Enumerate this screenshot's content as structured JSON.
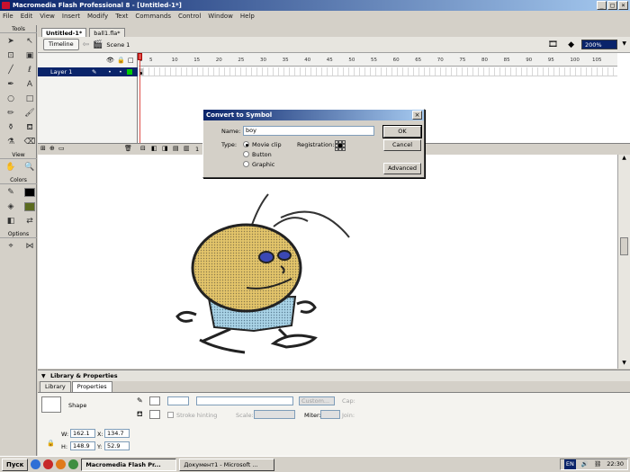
{
  "window": {
    "title": "Macromedia Flash Professional 8 - [Untitled-1*]",
    "controls": [
      "_",
      "□",
      "×"
    ]
  },
  "menu": [
    "File",
    "Edit",
    "View",
    "Insert",
    "Modify",
    "Text",
    "Commands",
    "Control",
    "Window",
    "Help"
  ],
  "tools": {
    "header": "Tools",
    "view_label": "View",
    "colors_label": "Colors",
    "options_label": "Options",
    "stroke_color": "#000000",
    "fill_color": "#5c6b1f"
  },
  "documents": {
    "tabs": [
      "Untitled-1*",
      "ball1.fla*"
    ]
  },
  "timeline": {
    "button": "Timeline",
    "scene": "Scene 1",
    "zoom": "200%",
    "layer_name": "Layer 1",
    "ruler_ticks": [
      "1",
      "5",
      "10",
      "15",
      "20",
      "25",
      "30",
      "35",
      "40",
      "45",
      "50",
      "55",
      "60",
      "65",
      "70",
      "75",
      "80",
      "85",
      "90",
      "95",
      "100",
      "105"
    ],
    "current_frame": "1"
  },
  "dialog": {
    "title": "Convert to Symbol",
    "name_label": "Name:",
    "name_value": "boy",
    "type_label": "Type:",
    "options": [
      "Movie clip",
      "Button",
      "Graphic"
    ],
    "selected_option": "Movie clip",
    "registration_label": "Registration:",
    "ok": "OK",
    "cancel": "Cancel",
    "advanced": "Advanced"
  },
  "properties": {
    "panel_title": "Library & Properties",
    "tabs": [
      "Library",
      "Properties"
    ],
    "active_tab": "Properties",
    "object_type": "Shape",
    "custom_btn": "Custom...",
    "cap_label": "Cap:",
    "stroke_hinting": "Stroke hinting",
    "scale_label": "Scale:",
    "miter_label": "Miter:",
    "join_label": "Join:",
    "w_label": "W:",
    "w_value": "162.1",
    "h_label": "H:",
    "h_value": "148.9",
    "x_label": "X:",
    "x_value": "134.7",
    "y_label": "Y:",
    "y_value": "52.9"
  },
  "taskbar": {
    "start": "Пуск",
    "tasks": [
      "Macromedia Flash Pr...",
      "Документ1 - Microsoft ..."
    ],
    "lang": "EN",
    "time": "22:30"
  }
}
